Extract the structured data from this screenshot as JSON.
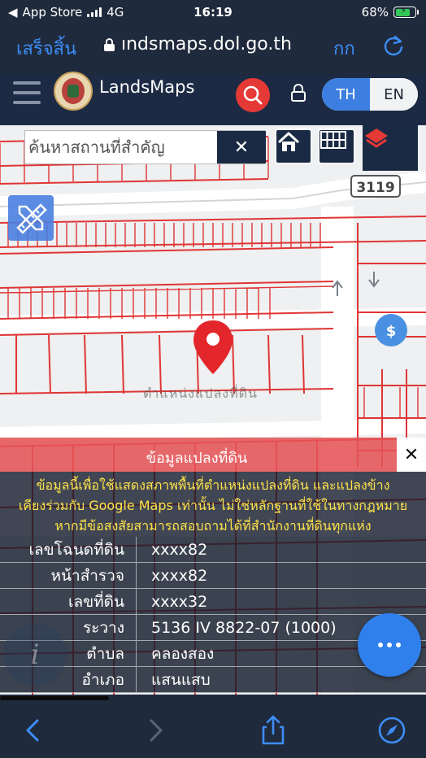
{
  "status_bar": {
    "carrier": "App Store",
    "network": "4G",
    "time": "16:19",
    "battery": "68%"
  },
  "browser": {
    "done_label": "เสร็จสิ้น",
    "url": "ındsmaps.dol.go.th",
    "text_size_label": "กก"
  },
  "app": {
    "name": "LandsMaps",
    "lang_th": "TH",
    "lang_en": "EN",
    "active_lang": "TH"
  },
  "map": {
    "search_placeholder": "ค้นหาสถานที่สำคัญ",
    "clear_label": "✕",
    "road_label": "3119",
    "pin_label": "ตำแหน่งแปลงที่ดิน"
  },
  "panel": {
    "title": "ข้อมูลแปลงที่ดิน",
    "close_label": "✕",
    "notice_lines": [
      "ข้อมูลนี้เพื่อใช้แสดงสภาพพื้นที่ตำแหน่งแปลงที่ดิน และแปลงข้าง",
      "เคียงร่วมกับ Google Maps เท่านั้น ไม่ใช่หลักฐานที่ใช้ในทางกฎหมาย",
      "หากมีข้อสงสัยสามารถสอบถามได้ที่สำนักงานที่ดินทุกแห่ง"
    ],
    "rows": [
      {
        "label": "เลขโฉนดที่ดิน",
        "value": "xxxx82"
      },
      {
        "label": "หน้าสำรวจ",
        "value": "xxxx82"
      },
      {
        "label": "เลขที่ดิน",
        "value": "xxxx32"
      },
      {
        "label": "ระวาง",
        "value": "5136 IV 8822-07 (1000)"
      },
      {
        "label": "ตำบล",
        "value": "คลองสอง"
      },
      {
        "label": "อำเภอ",
        "value": "แสนแสบ"
      }
    ]
  },
  "colors": {
    "accent": "#3d7fe0",
    "parcel_line": "#e03535",
    "panel_header": "#e55357",
    "notice_text": "#ffe34a",
    "fab": "#2f80ed"
  }
}
